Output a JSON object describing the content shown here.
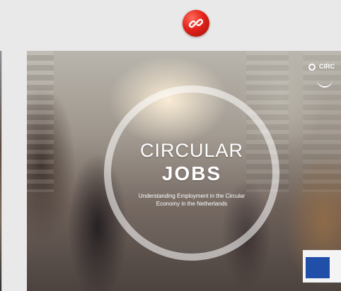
{
  "share": {
    "icon": "link-icon"
  },
  "cover": {
    "title_line1": "CIRCULAR",
    "title_line2": "JOBS",
    "subtitle": "Understanding Employment in the Circular Economy in the Netherlands",
    "logo_text": "CIRC"
  },
  "colors": {
    "link_button": "#e2231a",
    "background": "#e9e9e9"
  }
}
